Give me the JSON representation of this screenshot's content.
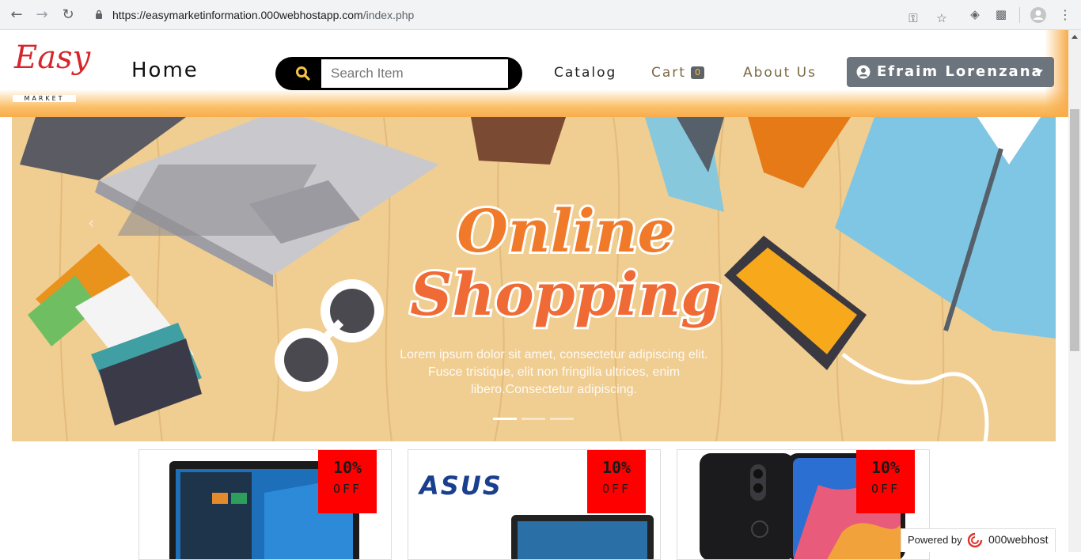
{
  "browser": {
    "url_host": "https://easymarketinformation.000webhostapp.com",
    "url_path": "/index.php"
  },
  "site": {
    "logo_text": "Easy",
    "logo_sub": "MARKET",
    "nav": {
      "home": "Home",
      "catalog": "Catalog",
      "cart": "Cart",
      "cart_count": "0",
      "about": "About Us"
    },
    "search": {
      "placeholder": "Search Item"
    },
    "user": {
      "name": "Efraim Lorenzana"
    }
  },
  "carousel": {
    "headline_1": "Online",
    "headline_2": "Shopping",
    "caption": "Lorem ipsum dolor sit amet, consectetur adipiscing elit. Fusce tristique, elit non fringilla ultrices, enim libero.Consectetur adipiscing.",
    "slides": 3,
    "active_slide": 1
  },
  "products": [
    {
      "discount": "10%",
      "off": "OFF",
      "image": "laptop-windows"
    },
    {
      "discount": "10%",
      "off": "OFF",
      "image": "asus-laptop",
      "brand_text": "ASUS"
    },
    {
      "discount": "10%",
      "off": "OFF",
      "image": "smartphone"
    }
  ],
  "footer": {
    "powered_label": "Powered by",
    "powered_brand": "000webhost"
  },
  "colors": {
    "header_glow": "#f8ad4c",
    "badge_red": "#ff0000",
    "user_button": "#6c757d",
    "logo_red": "#d6262b"
  }
}
